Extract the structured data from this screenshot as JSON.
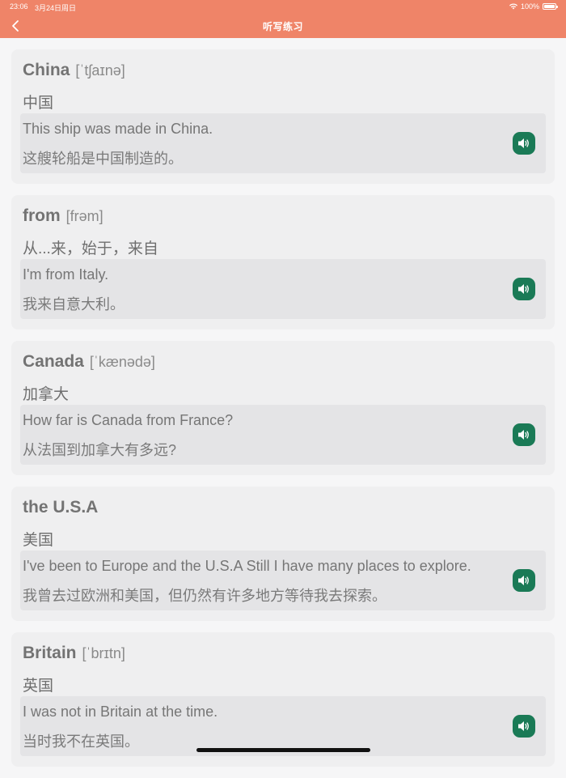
{
  "status_bar": {
    "time": "23:06",
    "date": "3月24日周日",
    "battery": "100%"
  },
  "nav": {
    "title": "听写练习",
    "back_icon": "chevron-left-icon"
  },
  "colors": {
    "header": "#ef8468",
    "speaker": "#1a7a56",
    "card": "#efeff0",
    "example_bg": "#e4e4e6"
  },
  "cards": [
    {
      "word": "China",
      "phonetic": "[ˈtʃaɪnə]",
      "meaning": "中国",
      "example_en": "This ship was made in China.",
      "example_zh": "这艘轮船是中国制造的。"
    },
    {
      "word": "from",
      "phonetic": "[frəm]",
      "meaning": "从...来，始于，来自",
      "example_en": "I'm from Italy.",
      "example_zh": "我来自意大利。"
    },
    {
      "word": "Canada",
      "phonetic": "[ˈkænədə]",
      "meaning": "加拿大",
      "example_en": "How far is Canada from France?",
      "example_zh": "从法国到加拿大有多远?"
    },
    {
      "word": "the U.S.A",
      "phonetic": "",
      "meaning": "美国",
      "example_en": "I've been to Europe and the U.S.A Still I have many places to explore.",
      "example_zh": "我曾去过欧洲和美国，但仍然有许多地方等待我去探索。"
    },
    {
      "word": "Britain",
      "phonetic": "[ˈbrɪtn]",
      "meaning": "英国",
      "example_en": "I was not in Britain at the time.",
      "example_zh": "当时我不在英国。"
    }
  ]
}
